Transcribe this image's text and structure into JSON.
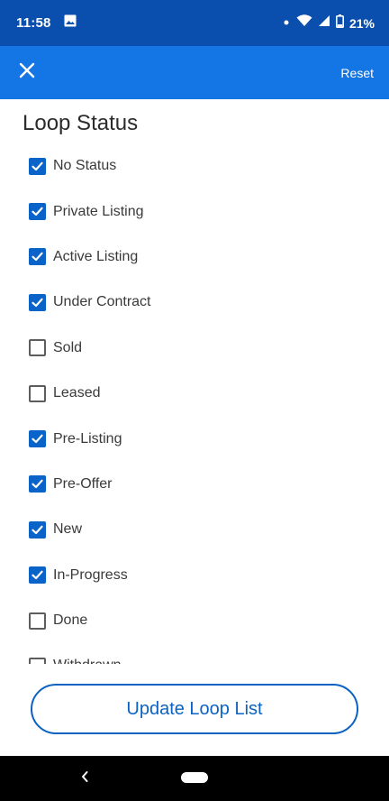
{
  "status_bar": {
    "time": "11:58",
    "battery": "21%",
    "icons": [
      "image-icon",
      "dot-icon",
      "wifi-icon",
      "signal-icon",
      "battery-icon"
    ]
  },
  "app_bar": {
    "close_icon": "close-icon",
    "reset_label": "Reset",
    "color": "#1476e4"
  },
  "section": {
    "title": "Loop Status"
  },
  "statuses": [
    {
      "label": "No Status",
      "checked": true
    },
    {
      "label": "Private Listing",
      "checked": true
    },
    {
      "label": "Active Listing",
      "checked": true
    },
    {
      "label": "Under Contract",
      "checked": true
    },
    {
      "label": "Sold",
      "checked": false
    },
    {
      "label": "Leased",
      "checked": false
    },
    {
      "label": "Pre-Listing",
      "checked": true
    },
    {
      "label": "Pre-Offer",
      "checked": true
    },
    {
      "label": "New",
      "checked": true
    },
    {
      "label": "In-Progress",
      "checked": true
    },
    {
      "label": "Done",
      "checked": false
    },
    {
      "label": "Withdrawn",
      "checked": false
    }
  ],
  "update_button": {
    "label": "Update Loop List",
    "color": "#0b62c3"
  },
  "nav_bar": {
    "icons": [
      "back-icon",
      "home-pill-icon"
    ]
  }
}
